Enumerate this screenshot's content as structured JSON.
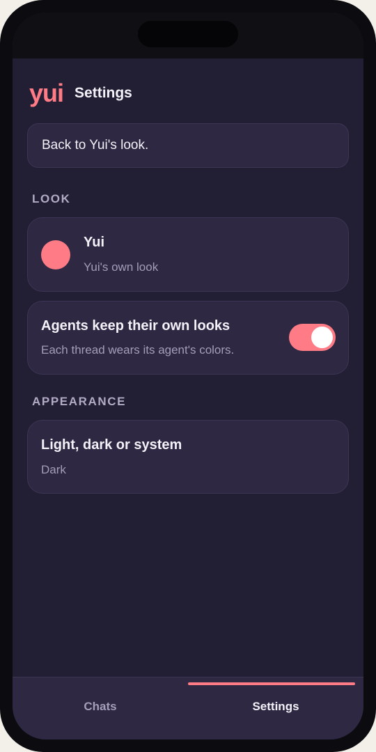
{
  "header": {
    "logo": "yui",
    "title": "Settings"
  },
  "back_banner": {
    "label": "Back to Yui's look."
  },
  "look_section": {
    "label": "LOOK",
    "theme": {
      "name": "Yui",
      "subtitle": "Yui's own look",
      "color": "#ff7b86",
      "icon": "color-swatch-dot"
    },
    "agents_toggle": {
      "title": "Agents keep their own looks",
      "subtitle": "Each thread wears its agent's colors.",
      "enabled": true
    }
  },
  "appearance_section": {
    "label": "APPEARANCE",
    "mode": {
      "title": "Light, dark or system",
      "value": "Dark"
    }
  },
  "tab_bar": {
    "tabs": [
      {
        "label": "Chats",
        "active": false
      },
      {
        "label": "Settings",
        "active": true
      }
    ]
  },
  "colors": {
    "accent": "#ff7b86",
    "background": "#221e33",
    "card": "#2e2842"
  }
}
